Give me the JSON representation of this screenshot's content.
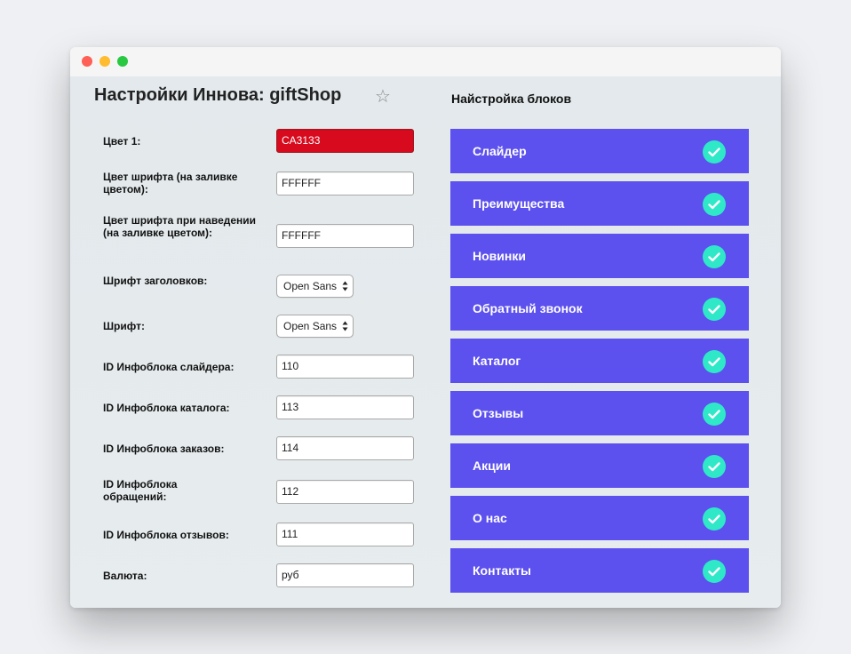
{
  "window": {
    "controls": [
      "close",
      "minimize",
      "maximize"
    ]
  },
  "page": {
    "title": "Настройки Иннова: giftShop",
    "favorite_icon": "star-icon"
  },
  "settings": {
    "color1": {
      "label": "Цвет 1:",
      "value": "CA3133",
      "fill": "#d80a1e"
    },
    "font_color": {
      "label": "Цвет шрифта (на заливке цветом):",
      "value": "FFFFFF"
    },
    "hover_font_color": {
      "label": "Цвет шрифта при наведении (на заливке цветом):",
      "value": "FFFFFF"
    },
    "heading_font": {
      "label": "Шрифт заголовков:",
      "value": "Open Sans"
    },
    "font": {
      "label": "Шрифт:",
      "value": "Open Sans"
    },
    "slider_iblock": {
      "label": "ID Инфоблока слайдера:",
      "value": "110"
    },
    "catalog_iblock": {
      "label": "ID Инфоблока каталога:",
      "value": "113"
    },
    "orders_iblock": {
      "label": "ID Инфоблока заказов:",
      "value": "114"
    },
    "requests_iblock": {
      "label": "ID Инфоблока обращений:",
      "value": "112"
    },
    "reviews_iblock": {
      "label": "ID Инфоблока отзывов:",
      "value": "111"
    },
    "currency": {
      "label": "Валюта:",
      "value": "руб"
    }
  },
  "blocks": {
    "title": "Найстройка блоков",
    "accent": "#5c50ee",
    "check_color": "#2fe8c8",
    "items": [
      {
        "label": "Слайдер",
        "enabled": true
      },
      {
        "label": "Преимущества",
        "enabled": true
      },
      {
        "label": "Новинки",
        "enabled": true
      },
      {
        "label": "Обратный звонок",
        "enabled": true
      },
      {
        "label": "Каталог",
        "enabled": true
      },
      {
        "label": "Отзывы",
        "enabled": true
      },
      {
        "label": "Акции",
        "enabled": true
      },
      {
        "label": "О нас",
        "enabled": true
      },
      {
        "label": "Контакты",
        "enabled": true
      }
    ]
  }
}
